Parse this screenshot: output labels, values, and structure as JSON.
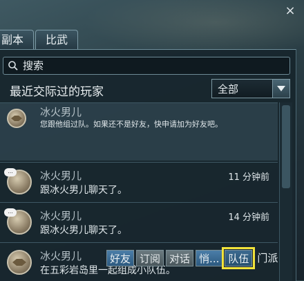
{
  "tabs": [
    {
      "label": "副本"
    },
    {
      "label": "比武"
    }
  ],
  "close_symbol": "×",
  "search": {
    "placeholder": "搜索",
    "value": ""
  },
  "section": {
    "title": "最近交际过的玩家"
  },
  "filter": {
    "selected": "全部"
  },
  "players": [
    {
      "name": "冰火男儿",
      "message": "您跟他组过队。如果还不是好友，快申请加为好友吧。",
      "time": "",
      "icon": "handshake-icon"
    },
    {
      "name": "冰火男儿",
      "message": "跟冰火男儿聊天了。",
      "time": "11 分钟前",
      "icon": "chat-bubble-icon"
    },
    {
      "name": "冰火男儿",
      "message": "跟冰火男儿聊天了。",
      "time": "14 分钟前",
      "icon": "chat-bubble-icon"
    },
    {
      "name": "冰火男儿",
      "message": "在五彩岩岛里一起组成小队伍。",
      "time": "",
      "icon": "handshake-icon"
    }
  ],
  "bubble_text": "...",
  "row4_time_fragment": "...",
  "actions": [
    {
      "label": "好友",
      "style": "blue"
    },
    {
      "label": "订阅",
      "style": "grey"
    },
    {
      "label": "对话",
      "style": "grey"
    },
    {
      "label": "悄...",
      "style": "blue"
    },
    {
      "label": "队伍",
      "style": "highlight"
    },
    {
      "label": "门派",
      "style": "plain"
    }
  ],
  "colors": {
    "highlight_outline": "#f2e33a",
    "action_blue": "#3b6d96",
    "panel_bg": "#18262e"
  }
}
